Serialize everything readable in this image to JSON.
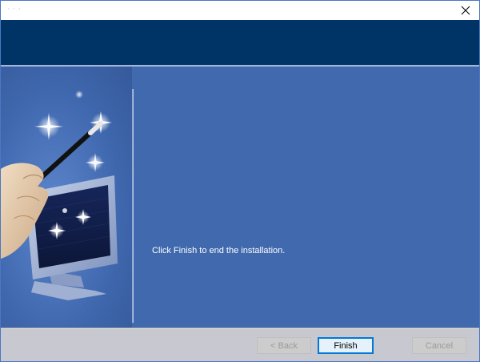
{
  "window": {
    "title": "· · ·"
  },
  "content": {
    "message": "Click Finish to end the installation."
  },
  "buttons": {
    "back_label": "< Back",
    "finish_label": "Finish",
    "cancel_label": "Cancel"
  },
  "colors": {
    "banner": "#003366",
    "content_background": "#4169ae",
    "footer": "#c8c8d0",
    "message_text": "#ffffff"
  },
  "icons": {
    "close": "close-icon",
    "wizard_art": "magic-wand-computer-icon"
  }
}
